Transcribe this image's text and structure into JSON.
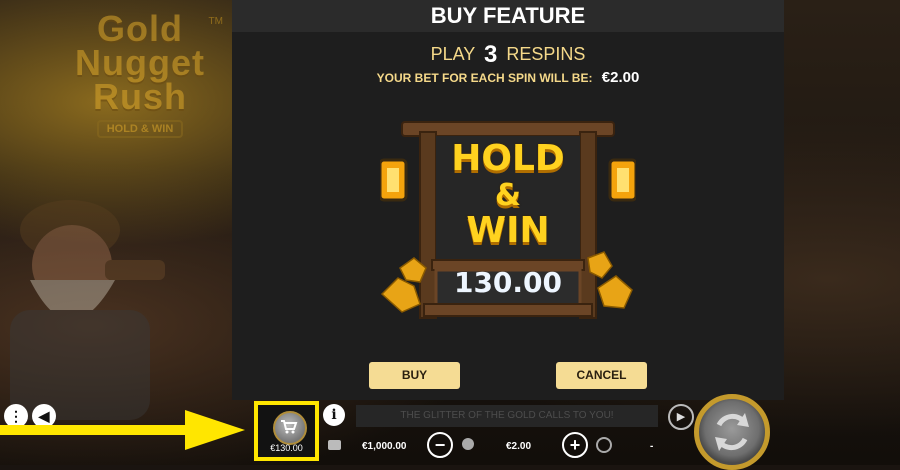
{
  "modal": {
    "title": "BUY FEATURE",
    "play_prefix": "PLAY",
    "respins_count": "3",
    "play_suffix": "RESPINS",
    "bet_text": "YOUR BET FOR EACH SPIN WILL BE:",
    "bet_value": "€2.00",
    "art": {
      "line1": "HOLD",
      "line2": "&",
      "line3": "WIN",
      "value": "130.00"
    },
    "buy_label": "BUY",
    "cancel_label": "CANCEL"
  },
  "logo": {
    "line1": "Gold",
    "line2": "Nugget",
    "line3": "Rush",
    "tm": "TM",
    "subtitle": "HOLD & WIN"
  },
  "bottom_bar": {
    "message": "THE GLITTER OF THE GOLD CALLS TO YOU!",
    "buy_feature_price": "€130.00",
    "balance": "€1,000.00",
    "bet": "€2.00",
    "win": "-"
  },
  "colors": {
    "accent": "#f5dc94",
    "highlight": "#ffe600",
    "gold": "#c49a2c",
    "modal_bg": "#1e1e1e"
  },
  "icons": [
    "menu-dots-icon",
    "sound-icon",
    "info-icon",
    "wallet-icon",
    "minus-icon",
    "coins-icon",
    "plus-icon",
    "medal-icon",
    "autoplay-icon",
    "spin-icon",
    "cart-icon",
    "arrow-icon"
  ]
}
